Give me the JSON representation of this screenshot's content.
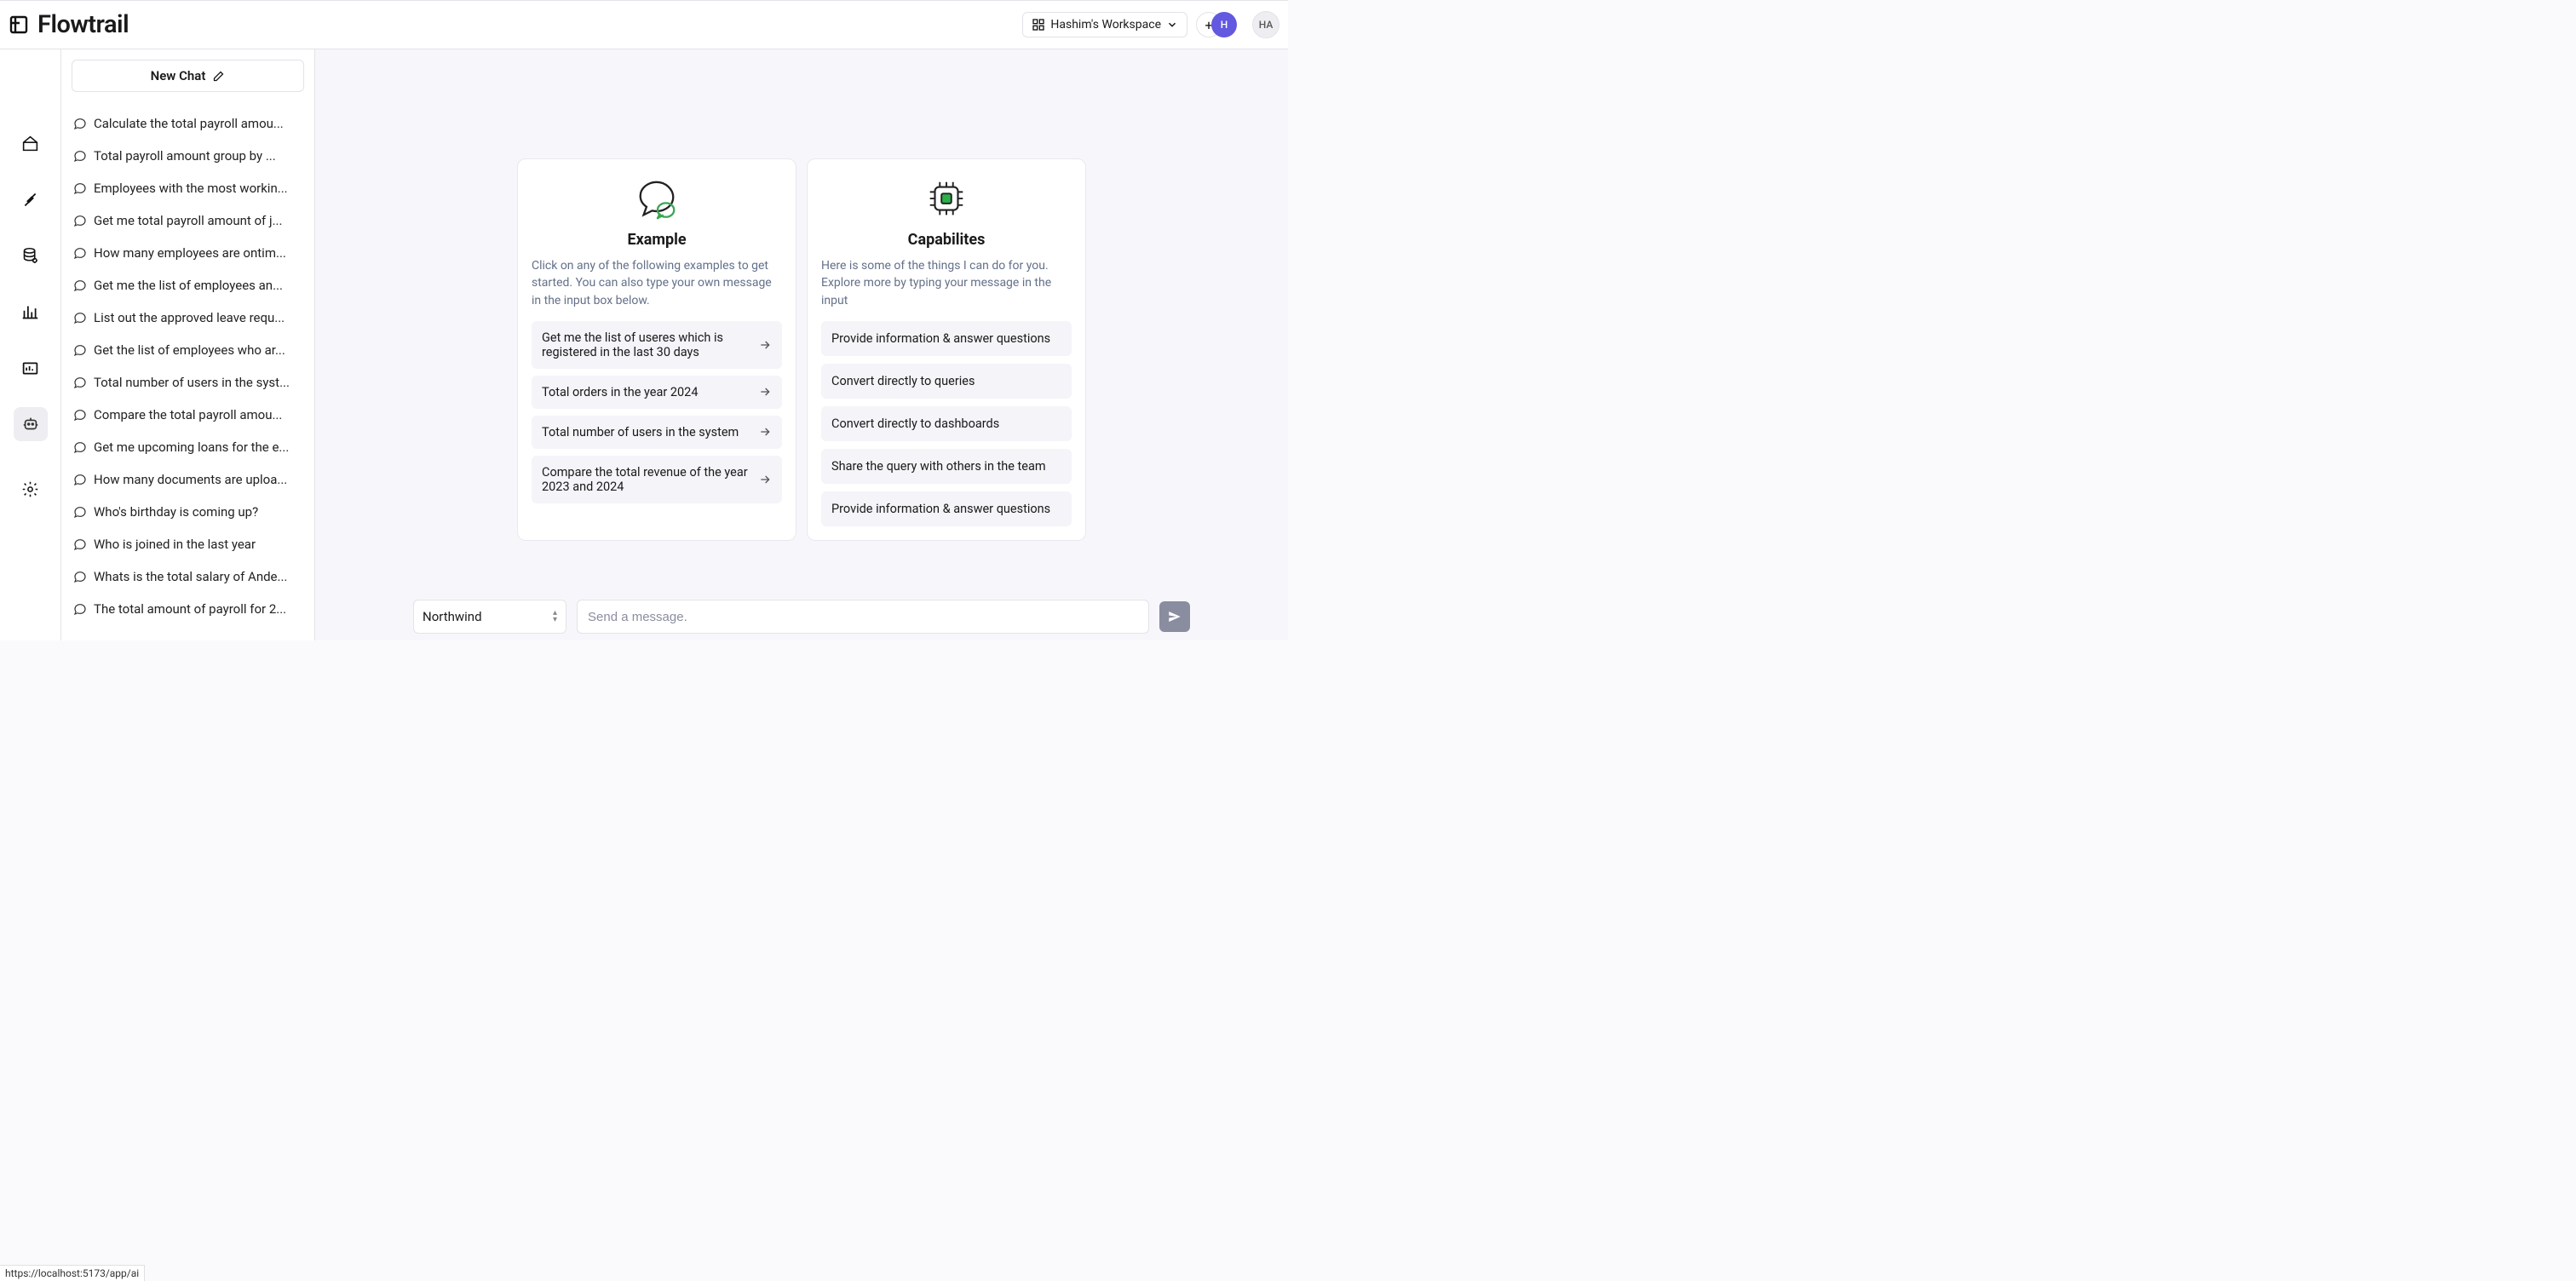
{
  "brand": "Flowtrail",
  "header": {
    "workspace_label": "Hashim's Workspace",
    "avatar_small": "H",
    "avatar_large": "HA"
  },
  "sidebar": {
    "new_chat_label": "New Chat",
    "chats": [
      "Calculate the total payroll amou...",
      "Total payroll amount group by ...",
      "Employees with the most workin...",
      "Get me total payroll amount of j...",
      "How many employees are ontim...",
      "Get me the list of employees an...",
      "List out the approved leave requ...",
      "Get the list of employees who ar...",
      "Total number of users in the syst...",
      "Compare the total payroll amou...",
      "Get me upcoming loans for the e...",
      "How many documents are uploa...",
      "Who's birthday is coming up?",
      "Who is joined in the last year",
      "Whats is the total salary of Ande...",
      "The total amount of payroll for 2..."
    ]
  },
  "example_card": {
    "title": "Example",
    "desc": "Click on any of the following examples to get started. You can also type your own message in the input box below.",
    "items": [
      "Get me the list of useres which is registered in the last 30 days",
      "Total orders in the year 2024",
      "Total number of users in the system",
      "Compare the total revenue of the year 2023 and 2024"
    ]
  },
  "capabilities_card": {
    "title": "Capabilites",
    "desc": "Here is some of the things I can do for you. Explore more by typing your message in the input",
    "items": [
      "Provide information & answer questions",
      "Convert directly to queries",
      "Convert directly to dashboards",
      "Share the query with others in the team",
      "Provide information & answer questions"
    ]
  },
  "composer": {
    "db_selected": "Northwind",
    "placeholder": "Send a message."
  },
  "status_url": "https://localhost:5173/app/ai"
}
